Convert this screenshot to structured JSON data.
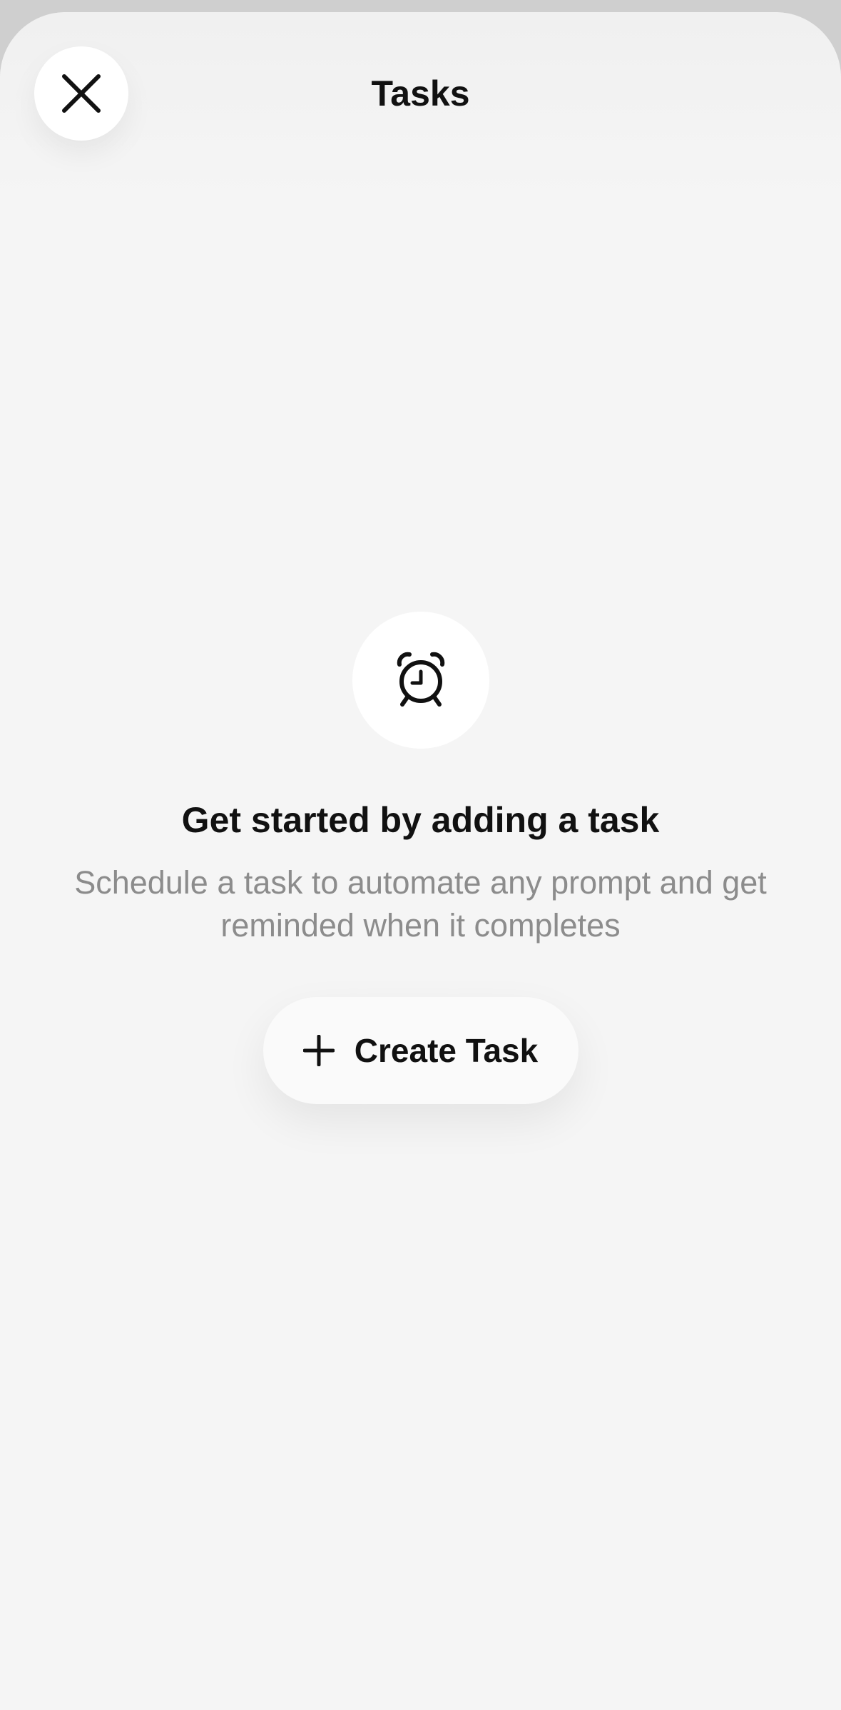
{
  "header": {
    "title": "Tasks",
    "close_icon": "close-icon"
  },
  "empty_state": {
    "icon": "alarm-clock-icon",
    "heading": "Get started by adding a task",
    "description": "Schedule a task to automate any prompt and get reminded when it completes",
    "create_button": {
      "icon": "plus-icon",
      "label": "Create Task"
    }
  },
  "colors": {
    "background": "#f5f5f5",
    "card": "#ffffff",
    "text_primary": "#111111",
    "text_secondary": "#8c8c8c"
  }
}
